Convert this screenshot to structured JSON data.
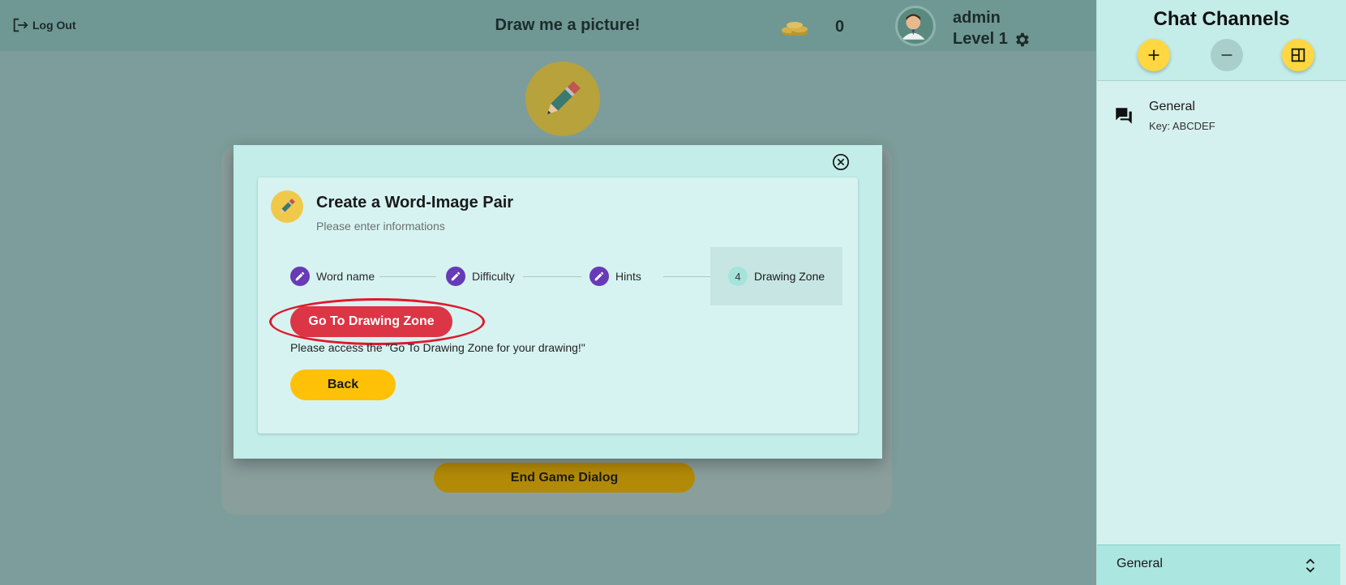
{
  "header": {
    "logout_label": "Log Out",
    "title": "Draw me a picture!",
    "coin_count": "0",
    "username": "admin",
    "level": "Level 1"
  },
  "background": {
    "end_game_label": "End Game Dialog"
  },
  "chat": {
    "title": "Chat Channels",
    "channels": [
      {
        "name": "General",
        "key": "Key: ABCDEF"
      }
    ],
    "selected_channel": "General"
  },
  "modal": {
    "title": "Create a Word-Image Pair",
    "subtitle": "Please enter informations",
    "steps": [
      {
        "label": "Word name",
        "state": "done"
      },
      {
        "label": "Difficulty",
        "state": "done"
      },
      {
        "label": "Hints",
        "state": "done"
      },
      {
        "label": "Drawing Zone",
        "state": "active",
        "number": "4"
      }
    ],
    "go_button_label": "Go To Drawing Zone",
    "instruction": "Please access the \"Go To Drawing Zone for your drawing!\"",
    "back_button_label": "Back"
  },
  "colors": {
    "accent_yellow": "#ffc107",
    "danger_red": "#dc3545",
    "step_purple": "#673ab7",
    "highlight_ring": "#e0182b"
  }
}
